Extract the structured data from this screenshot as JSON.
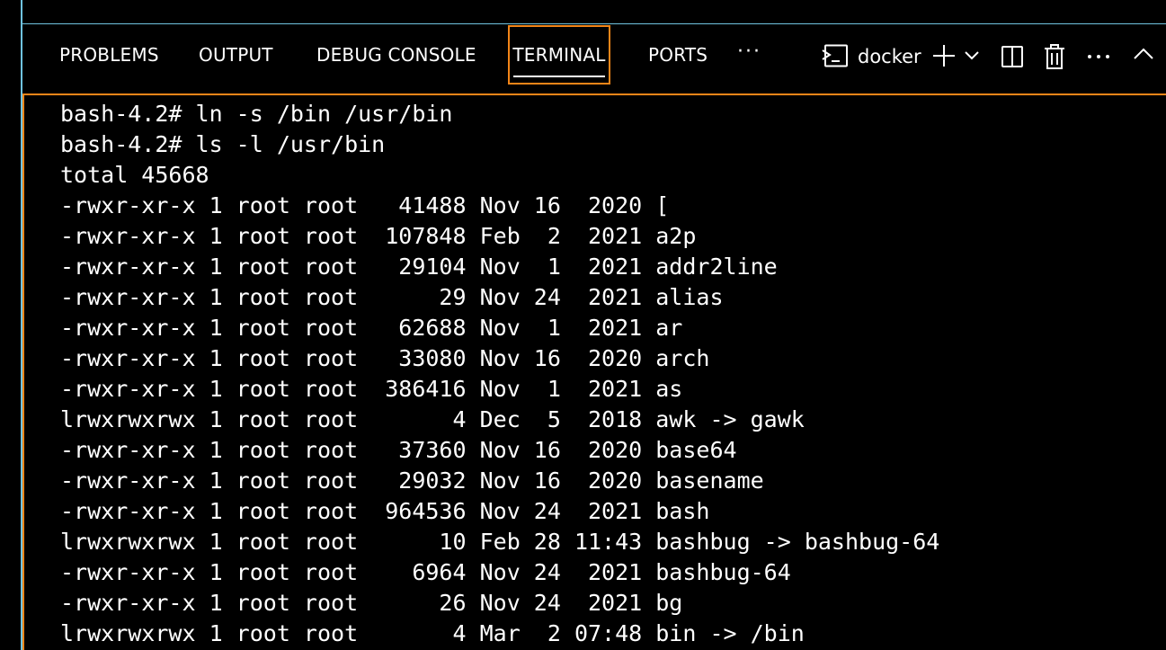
{
  "panel": {
    "tabs": [
      {
        "label": "PROBLEMS"
      },
      {
        "label": "OUTPUT"
      },
      {
        "label": "DEBUG CONSOLE"
      },
      {
        "label": "TERMINAL",
        "active": true
      },
      {
        "label": "PORTS"
      }
    ],
    "more_tabs_label": "···",
    "active_terminal_name": "docker",
    "icons": {
      "terminal_profile": "terminal-icon",
      "new_terminal": "plus-icon",
      "launch_profile": "chevron-down-icon",
      "split": "split-terminal-icon",
      "kill": "trash-icon",
      "more_actions": "ellipsis-icon",
      "maximize": "chevron-up-icon"
    },
    "accent_color": "#f38518",
    "border_color": "#6fc3df"
  },
  "terminal": {
    "lines": [
      "bash-4.2# ln -s /bin /usr/bin",
      "bash-4.2# ls -l /usr/bin",
      "total 45668",
      "-rwxr-xr-x 1 root root   41488 Nov 16  2020 [",
      "-rwxr-xr-x 1 root root  107848 Feb  2  2021 a2p",
      "-rwxr-xr-x 1 root root   29104 Nov  1  2021 addr2line",
      "-rwxr-xr-x 1 root root      29 Nov 24  2021 alias",
      "-rwxr-xr-x 1 root root   62688 Nov  1  2021 ar",
      "-rwxr-xr-x 1 root root   33080 Nov 16  2020 arch",
      "-rwxr-xr-x 1 root root  386416 Nov  1  2021 as",
      "lrwxrwxrwx 1 root root       4 Dec  5  2018 awk -> gawk",
      "-rwxr-xr-x 1 root root   37360 Nov 16  2020 base64",
      "-rwxr-xr-x 1 root root   29032 Nov 16  2020 basename",
      "-rwxr-xr-x 1 root root  964536 Nov 24  2021 bash",
      "lrwxrwxrwx 1 root root      10 Feb 28 11:43 bashbug -> bashbug-64",
      "-rwxr-xr-x 1 root root    6964 Nov 24  2021 bashbug-64",
      "-rwxr-xr-x 1 root root      26 Nov 24  2021 bg",
      "lrwxrwxrwx 1 root root       4 Mar  2 07:48 bin -> /bin"
    ]
  }
}
